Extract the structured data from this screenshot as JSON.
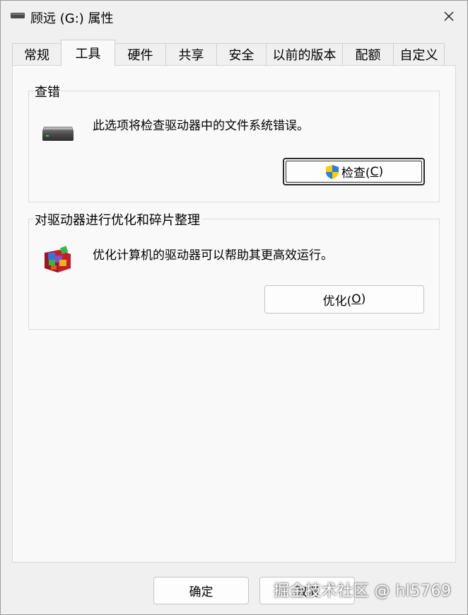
{
  "window": {
    "title": "顾远 (G:) 属性",
    "close_glyph": "✕"
  },
  "tabs": [
    {
      "label": "常规"
    },
    {
      "label": "工具"
    },
    {
      "label": "硬件"
    },
    {
      "label": "共享"
    },
    {
      "label": "安全"
    },
    {
      "label": "以前的版本"
    },
    {
      "label": "配额"
    },
    {
      "label": "自定义"
    }
  ],
  "active_tab": "工具",
  "error_check": {
    "title": "查错",
    "description": "此选项将检查驱动器中的文件系统错误。",
    "button_label": "检查(",
    "button_key": "C",
    "button_suffix": ")"
  },
  "optimize": {
    "title": "对驱动器进行优化和碎片整理",
    "description": "优化计算机的驱动器可以帮助其更高效运行。",
    "button_label": "优化(",
    "button_key": "O",
    "button_suffix": ")"
  },
  "footer": {
    "ok_label": "确定",
    "cancel_label": "取消"
  },
  "watermark": "掘金技术社区 @ hl5769"
}
